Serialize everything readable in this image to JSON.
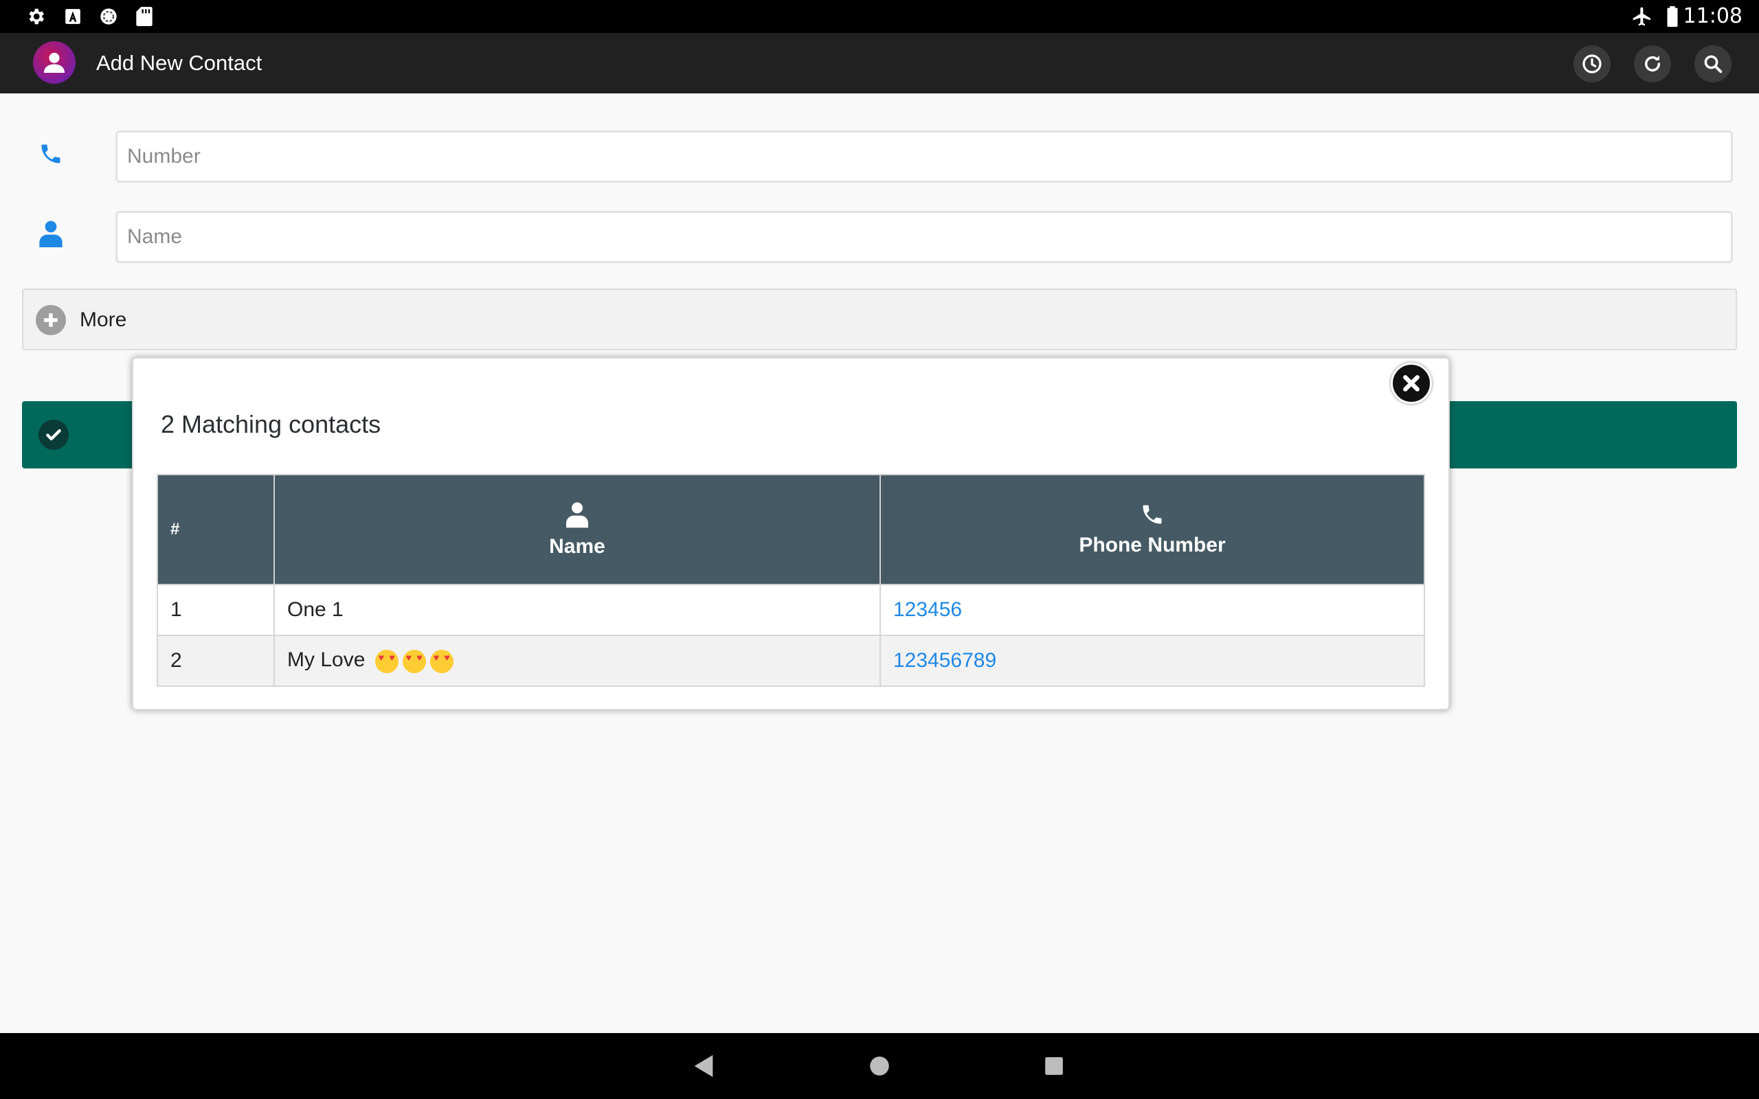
{
  "status_bar": {
    "time": "11:08",
    "left_icons": [
      "settings-icon",
      "keyboard-a-icon",
      "sync-circle-icon",
      "sd-card-icon"
    ],
    "right_icons": [
      "airplane-mode-icon",
      "battery-icon"
    ]
  },
  "app_bar": {
    "title": "Add New Contact",
    "actions": [
      "history-icon",
      "refresh-icon",
      "search-icon"
    ]
  },
  "form": {
    "number_placeholder": "Number",
    "number_value": "",
    "name_placeholder": "Name",
    "name_value": "",
    "more_label": "More"
  },
  "modal": {
    "title": "2 Matching contacts",
    "table": {
      "headers": {
        "num": "#",
        "name": "Name",
        "phone": "Phone Number"
      },
      "rows": [
        {
          "num": "1",
          "name": "One 1",
          "phone": "123456"
        },
        {
          "num": "2",
          "name": "My Love",
          "phone": "123456789",
          "emoji_count": 3
        }
      ]
    }
  },
  "colors": {
    "accent_blue": "#1e88e5",
    "save_green": "#00695c",
    "table_header": "#455a64",
    "app_bar": "#212121"
  }
}
